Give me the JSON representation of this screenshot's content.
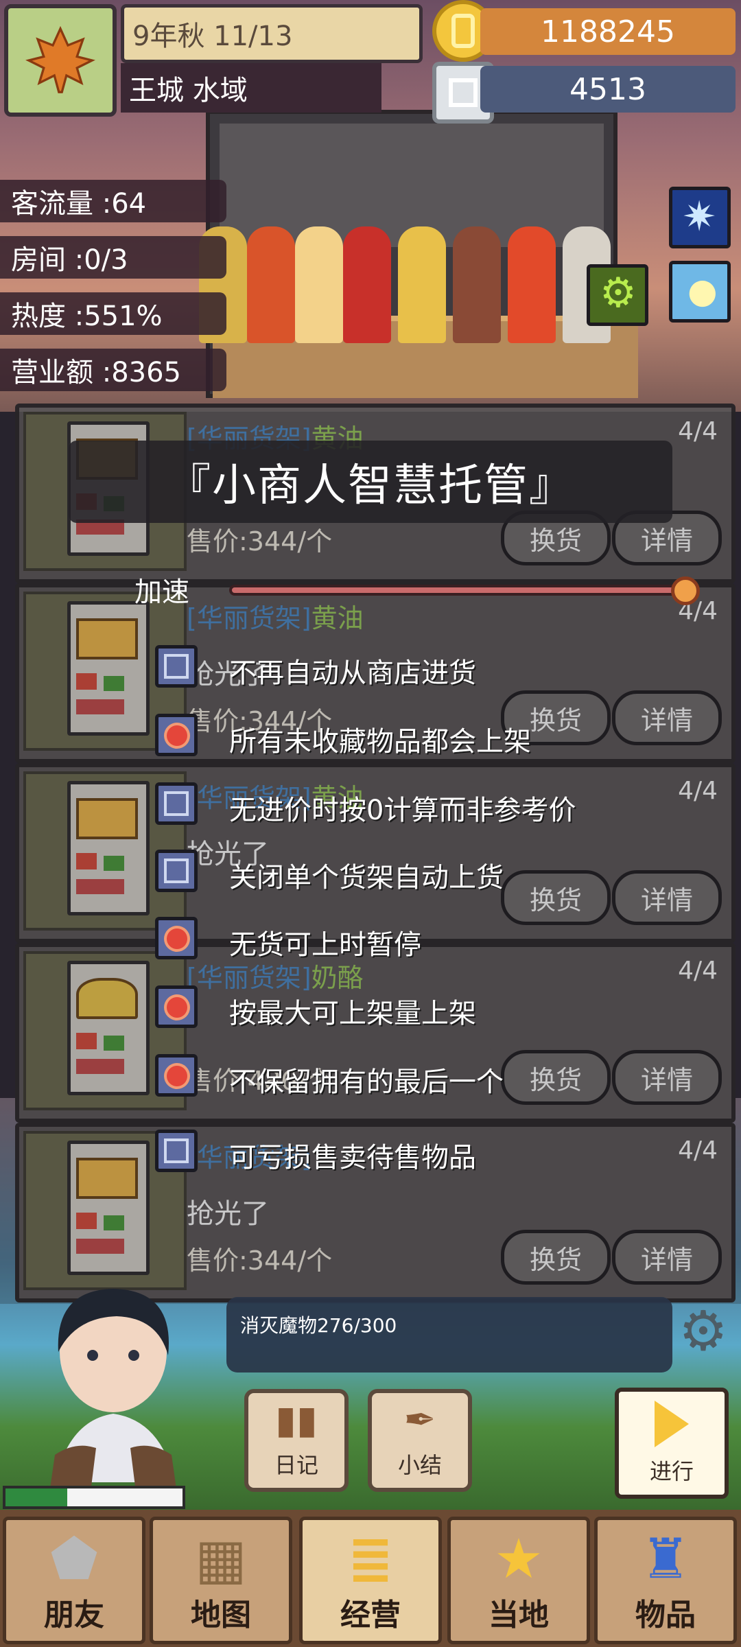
{
  "header": {
    "season_icon": "maple-leaf-icon",
    "date": "9年秋 11/13",
    "location": "王城 水域",
    "gold": "1188245",
    "silver": "4513"
  },
  "stats": [
    {
      "label": "客流量 :64"
    },
    {
      "label": "房间 :0/3"
    },
    {
      "label": "热度 :551%"
    },
    {
      "label": "营业额 :8365"
    }
  ],
  "shelves": [
    {
      "tag": "[华丽货架]",
      "item": "黄油",
      "count": "4/4",
      "status": "",
      "price": "售价:344/个"
    },
    {
      "tag": "[华丽货架]",
      "item": "黄油",
      "count": "4/4",
      "status": "抢光了",
      "price": "售价:344/个"
    },
    {
      "tag": "[华丽货架]",
      "item": "黄油",
      "count": "4/4",
      "status": "抢光了",
      "price": ""
    },
    {
      "tag": "[华丽货架]",
      "item": "奶酪",
      "count": "4/4",
      "status": "",
      "price": "售价:486/个"
    },
    {
      "tag": "[华丽货架]",
      "item": "",
      "count": "4/4",
      "status": "抢光了",
      "price": "售价:344/个"
    }
  ],
  "shelf_buttons": {
    "swap": "换货",
    "detail": "详情"
  },
  "overlay": {
    "title": "『小商人智慧托管』",
    "speed_label": "加速",
    "speed_value": 1.0,
    "options": [
      {
        "text": "不再自动从商店进货",
        "checked": false
      },
      {
        "text": "所有未收藏物品都会上架",
        "checked": true
      },
      {
        "text": "无进价时按0计算而非参考价",
        "checked": false
      },
      {
        "text": "关闭单个货架自动上货",
        "checked": false
      },
      {
        "text": "无货可上时暂停",
        "checked": true
      },
      {
        "text": "按最大可上架量上架",
        "checked": true
      },
      {
        "text": "不保留拥有的最后一个",
        "checked": true
      },
      {
        "text": "可亏损售卖待售物品",
        "checked": false
      }
    ]
  },
  "quest": {
    "text": "消灭魔物276/300"
  },
  "actions": {
    "diary": "日记",
    "summary": "小结",
    "next": "进行"
  },
  "player": {
    "hp_fraction": 0.35
  },
  "nav": [
    {
      "label": "朋友",
      "icon": "shield-icon"
    },
    {
      "label": "地图",
      "icon": "map-icon"
    },
    {
      "label": "经营",
      "icon": "coin-stack-icon"
    },
    {
      "label": "当地",
      "icon": "star-icon"
    },
    {
      "label": "物品",
      "icon": "bag-icon"
    }
  ],
  "colors": {
    "gold": "#d4863c",
    "silver": "#4c5a7a",
    "accent": "#f6c43a"
  }
}
